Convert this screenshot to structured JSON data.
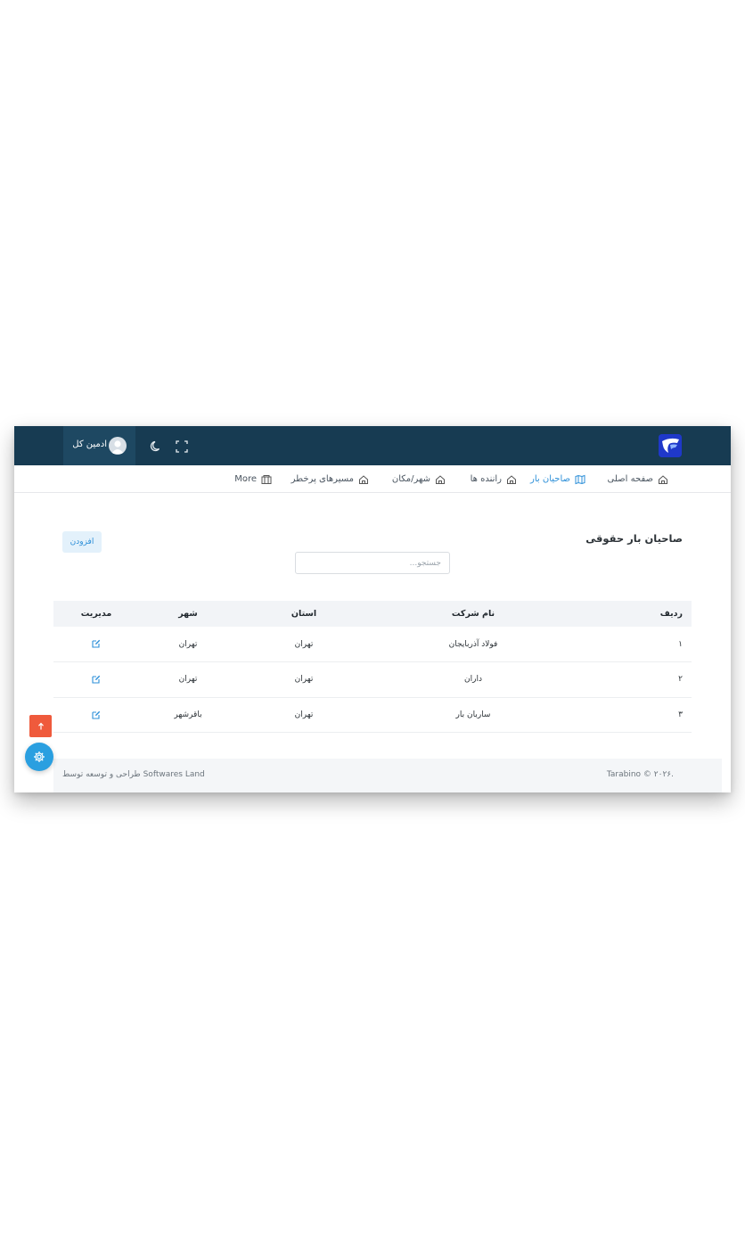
{
  "header": {
    "user_name": "ادمین کل",
    "logo_color": "#1f38c9",
    "bar_color": "#173b52"
  },
  "menu": {
    "items": [
      {
        "label": "صفحه اصلی",
        "icon": "home-icon"
      },
      {
        "label": "صاحیان بار",
        "icon": "map-icon",
        "active": true
      },
      {
        "label": "راننده ها",
        "icon": "home-icon"
      },
      {
        "label": "شهر/مکان",
        "icon": "home-icon"
      },
      {
        "label": "مسیرهای پرخطر",
        "icon": "home-icon"
      },
      {
        "label": "More",
        "icon": "columns-icon"
      }
    ]
  },
  "page": {
    "title": "صاحیان بار حقوقی",
    "add_label": "افزودن",
    "search_placeholder": "جستجو..."
  },
  "table": {
    "columns": [
      "ردیف",
      "نام شرکت",
      "استان",
      "شهر",
      "مدیریت"
    ],
    "rows": [
      {
        "index": "۱",
        "company": "فولاد آذربایجان",
        "province": "تهران",
        "city": "تهران"
      },
      {
        "index": "۲",
        "company": "داران",
        "province": "تهران",
        "city": "تهران"
      },
      {
        "index": "۳",
        "company": "ساربان بار",
        "province": "تهران",
        "city": "باقرشهر"
      }
    ]
  },
  "footer": {
    "copyright": "Tarabino © ۲۰۲۶.",
    "credit": "طراحی و توسعه توسط Softwares Land"
  },
  "colors": {
    "accent": "#2c8fd8",
    "scroll_top": "#ef5a3c",
    "fab": "#2a9fe0"
  }
}
